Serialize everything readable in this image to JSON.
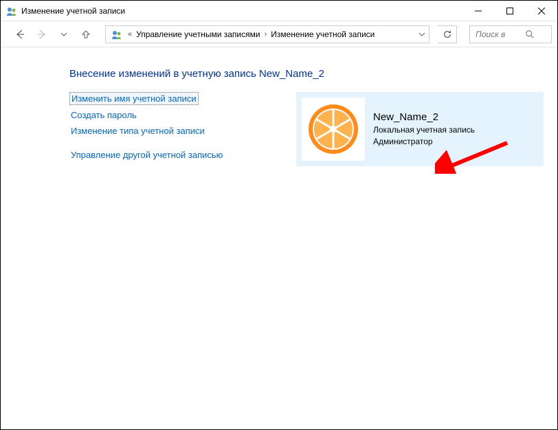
{
  "window": {
    "title": "Изменение учетной записи"
  },
  "breadcrumb": {
    "item1": "Управление учетными записями",
    "item2": "Изменение учетной записи"
  },
  "search": {
    "placeholder": "Поиск в"
  },
  "page": {
    "title": "Внесение изменений в учетную запись New_Name_2"
  },
  "links": {
    "rename": "Изменить имя учетной записи",
    "create_pwd": "Создать пароль",
    "change_type": "Изменение типа учетной записи",
    "manage_other": "Управление другой учетной записью"
  },
  "account": {
    "name": "New_Name_2",
    "type": "Локальная учетная запись",
    "role": "Администратор"
  }
}
